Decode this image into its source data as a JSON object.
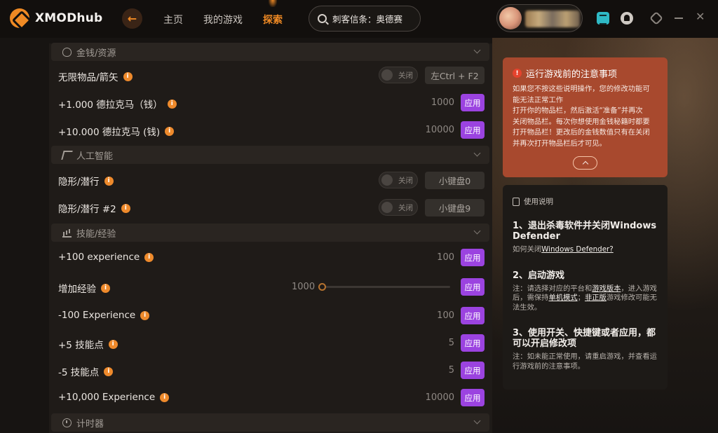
{
  "header": {
    "logo_text": "XMODhub",
    "nav": [
      {
        "label": "主页"
      },
      {
        "label": "我的游戏"
      },
      {
        "label": "探索"
      }
    ],
    "search_value": "刺客信条：奥德赛"
  },
  "sections": {
    "money": "金钱/资源",
    "ai": "人工智能",
    "skills": "技能/经验",
    "timer": "计时器"
  },
  "rows": {
    "infinite_items": {
      "label": "无限物品/箭矢",
      "toggle": "关闭",
      "hotkey": "左Ctrl + F2"
    },
    "drachma_1000": {
      "label": "+1.000 德拉克马（钱）",
      "value": "1000",
      "apply": "应用"
    },
    "drachma_10000": {
      "label": "+10.000 德拉克马 (钱)",
      "value": "10000",
      "apply": "应用"
    },
    "stealth": {
      "label": "隐形/潜行",
      "toggle": "关闭",
      "hotkey": "小键盘0"
    },
    "stealth2": {
      "label": "隐形/潜行 #2",
      "toggle": "关闭",
      "hotkey": "小键盘9"
    },
    "exp_100": {
      "label": "+100 experience",
      "value": "100",
      "apply": "应用"
    },
    "add_exp": {
      "label": "增加经验",
      "value": "1000",
      "apply": "应用"
    },
    "exp_minus_100": {
      "label": "-100 Experience",
      "value": "100",
      "apply": "应用"
    },
    "skill_plus_5": {
      "label": "+5 技能点",
      "value": "5",
      "apply": "应用"
    },
    "skill_minus_5": {
      "label": "-5 技能点",
      "value": "5",
      "apply": "应用"
    },
    "exp_10000": {
      "label": "+10,000 Experience",
      "value": "10000",
      "apply": "应用"
    }
  },
  "slider": {
    "level_fraction": 0.0
  },
  "notice": {
    "title": "运行游戏前的注意事项",
    "lines": [
      "如果您不按这些说明操作，您的修改功能可",
      "能无法正常工作",
      "打开你的物品栏，然后激活“准备”并再次",
      "关闭物品栏。每次你想使用金钱秘籍时都要",
      "打开物品栏！更改后的金钱数值只有在关闭",
      "并再次打开物品栏后才可见。"
    ]
  },
  "guide": {
    "header": "使用说明",
    "step1_title": "1、退出杀毒软件并关闭Windows Defender",
    "step1_sub_prefix": "如何关闭",
    "step1_sub_link": "Windows Defender?",
    "step2_title": "2、启动游戏",
    "step2_sub_a": "注：请选择对应的平台和",
    "step2_sub_b": "游戏版本",
    "step2_sub_c": "，进入游戏后，需保持",
    "step2_sub_d": "单机模式",
    "step2_sub_e": "；",
    "step2_sub_f": "非正版",
    "step2_sub_g": "游戏修改可能无法生效。",
    "step3_title": "3、使用开关、快捷键或者应用，都可以开启修改项",
    "step3_sub": "注：如未能正常使用，请重启游戏，并查看运行游戏前的注意事项。"
  },
  "colors": {
    "accent_orange": "#f08a24",
    "apply_purple": "#9b43e0",
    "notice_bg": "#a8492e"
  }
}
